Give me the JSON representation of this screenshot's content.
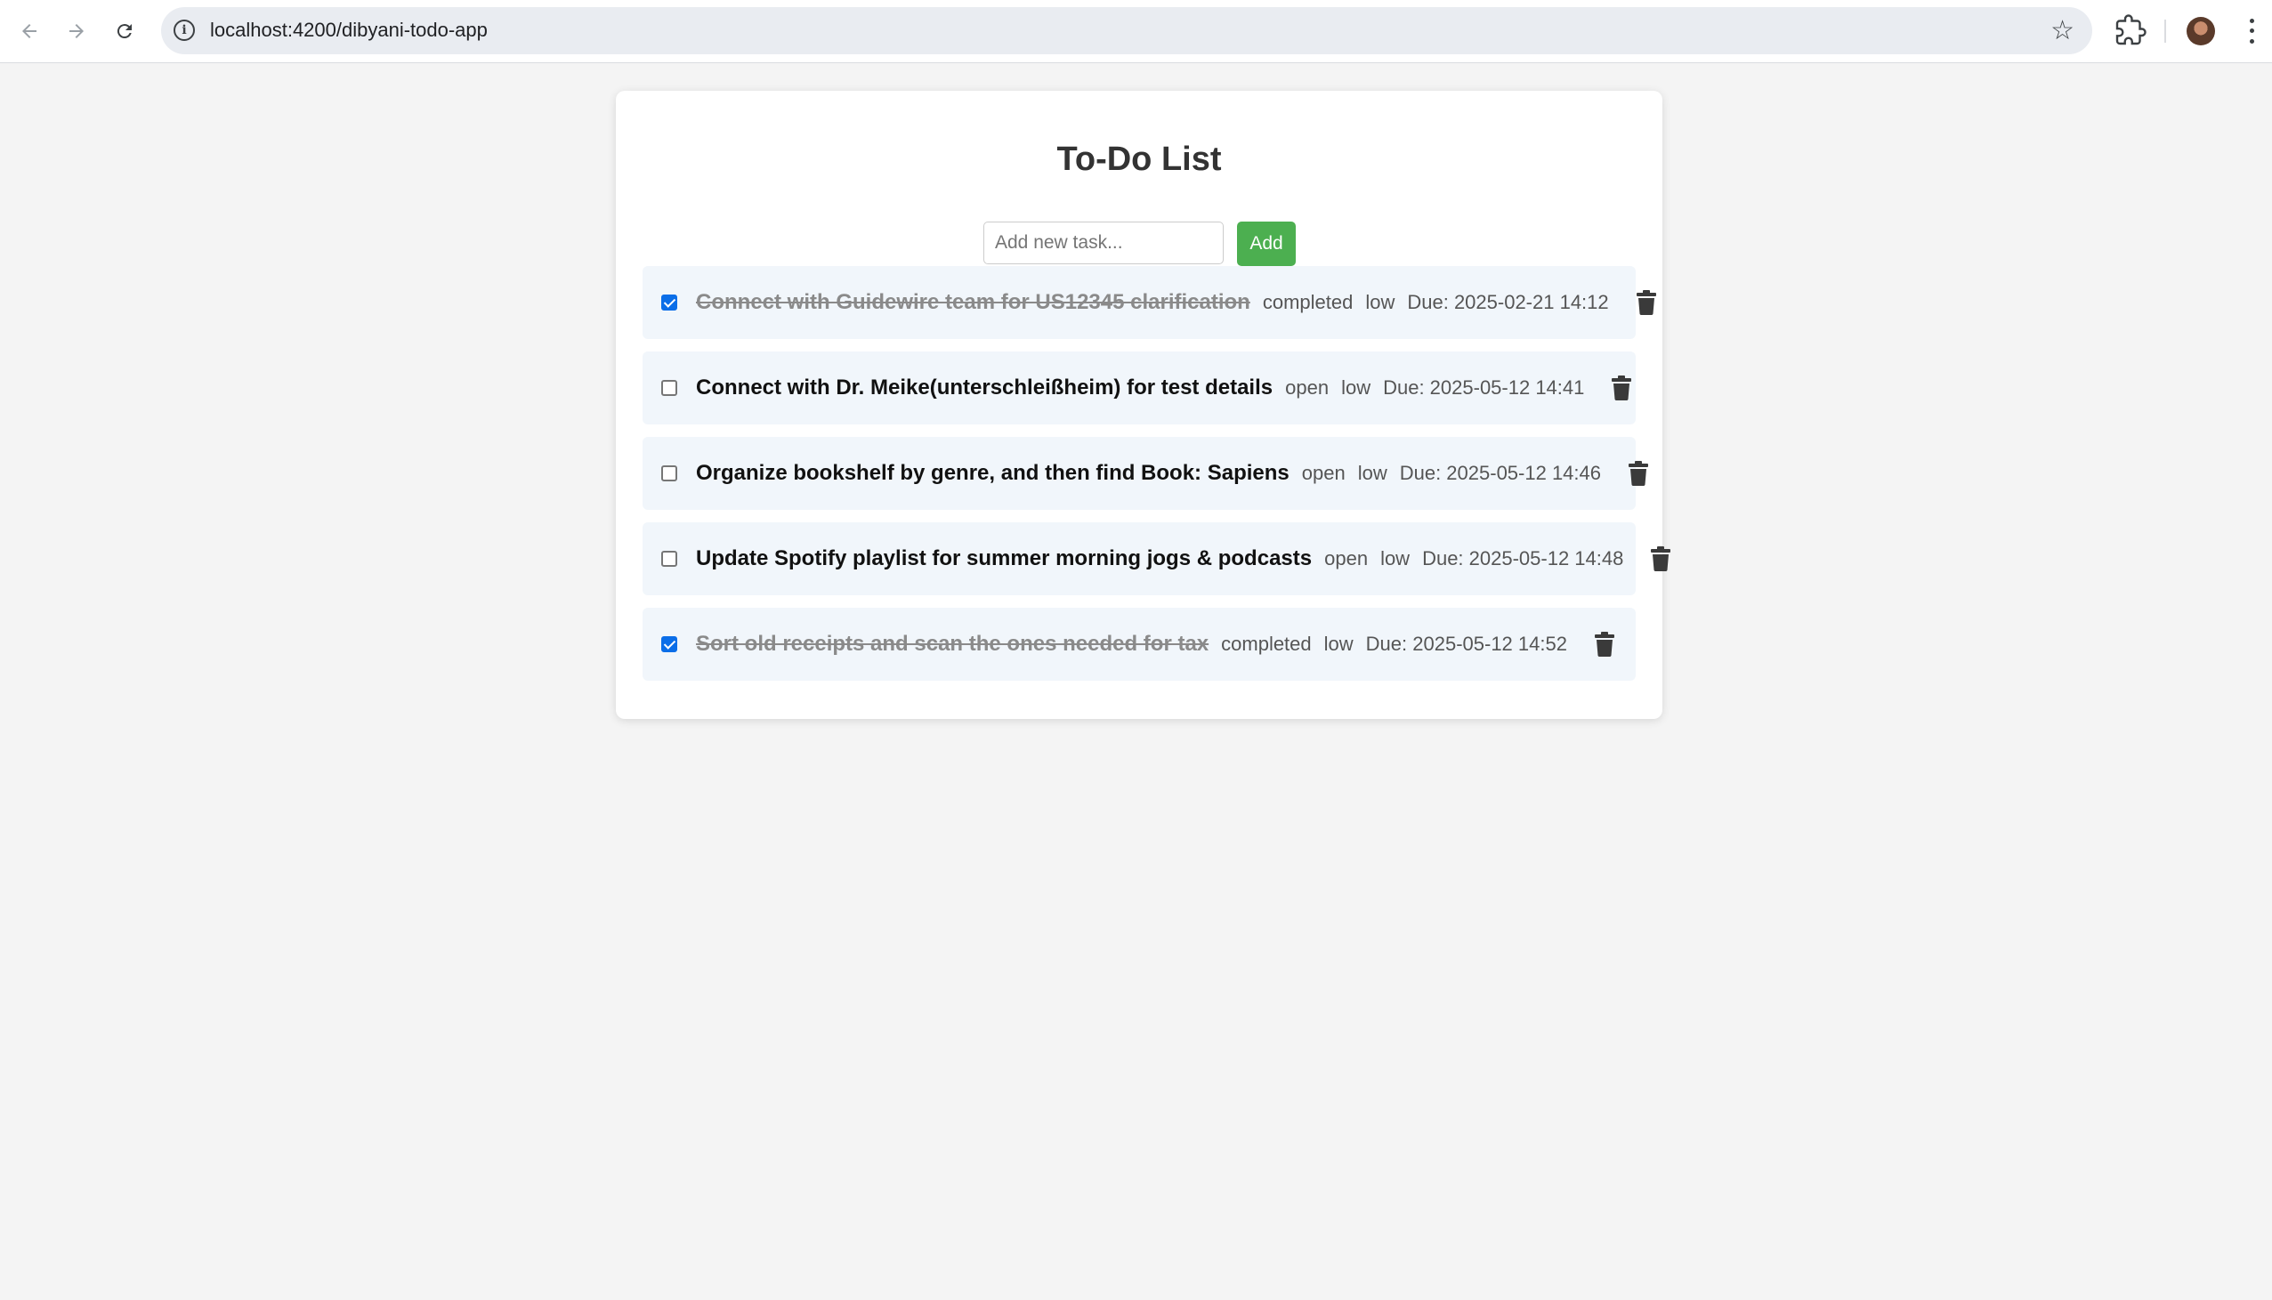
{
  "browser": {
    "url": "localhost:4200/dibyani-todo-app"
  },
  "app": {
    "title": "To-Do List",
    "input_placeholder": "Add new task...",
    "add_label": "Add",
    "accent_color": "#4caf50"
  },
  "todos": [
    {
      "text": "Connect with Guidewire team for US12345 clarification",
      "status": "completed",
      "priority": "low",
      "due": "Due: 2025-02-21 14:12",
      "checked": true
    },
    {
      "text": "Connect with Dr. Meike(unterschleißheim) for test details",
      "status": "open",
      "priority": "low",
      "due": "Due: 2025-05-12 14:41",
      "checked": false
    },
    {
      "text": "Organize bookshelf by genre, and then find Book: Sapiens",
      "status": "open",
      "priority": "low",
      "due": "Due: 2025-05-12 14:46",
      "checked": false
    },
    {
      "text": "Update Spotify playlist for summer morning jogs & podcasts",
      "status": "open",
      "priority": "low",
      "due": "Due: 2025-05-12 14:48",
      "checked": false
    },
    {
      "text": "Sort old receipts and scan the ones needed for tax",
      "status": "completed",
      "priority": "low",
      "due": "Due: 2025-05-12 14:52",
      "checked": true
    }
  ]
}
